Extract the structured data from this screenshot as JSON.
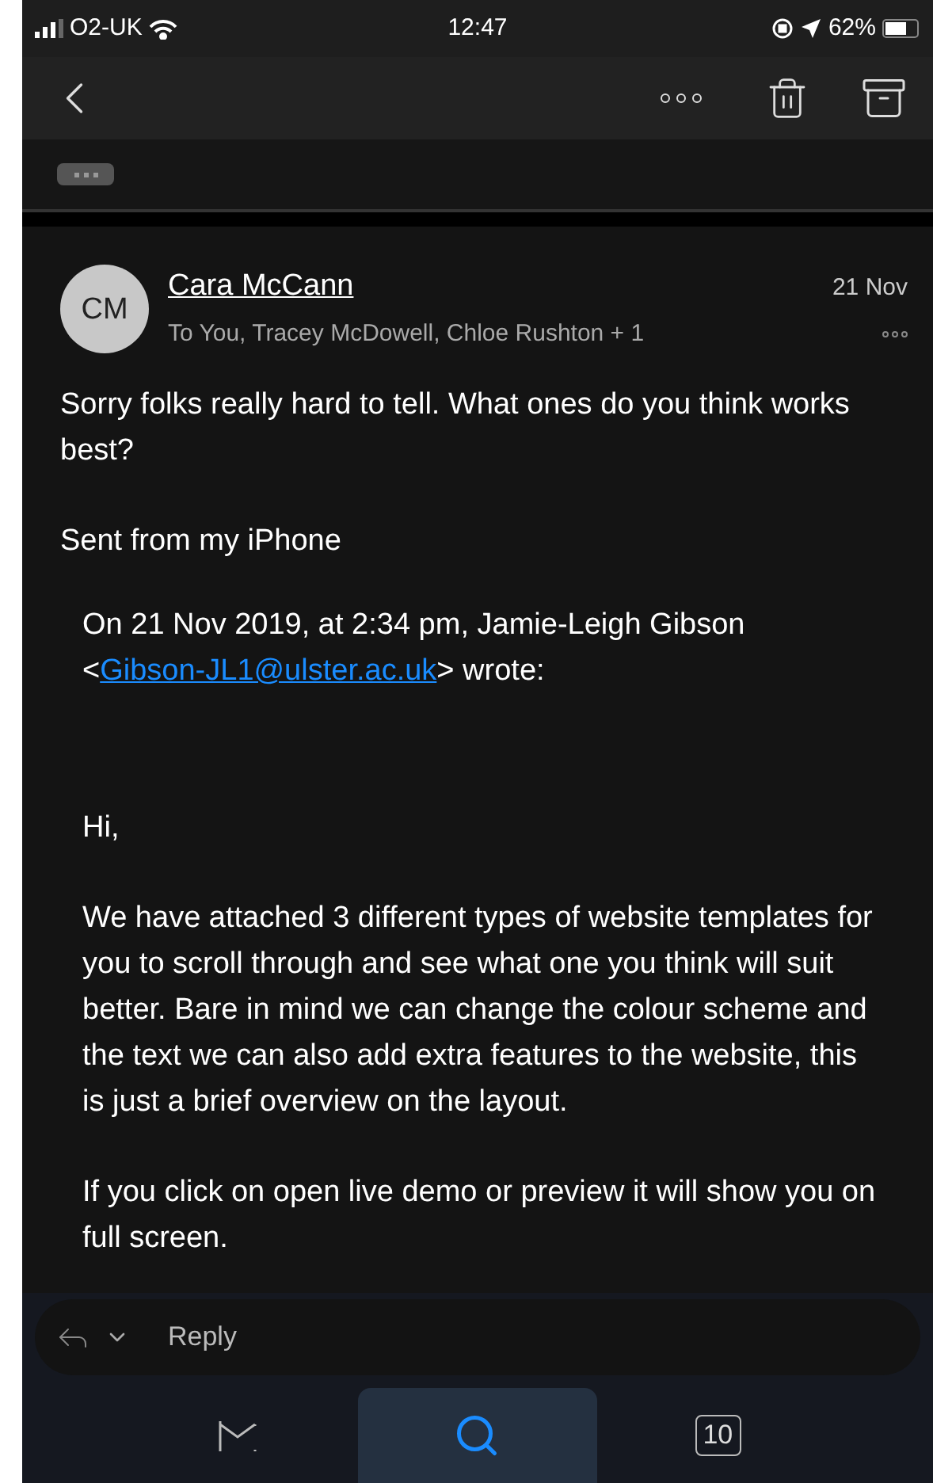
{
  "status_bar": {
    "carrier": "O2-UK",
    "time": "12:47",
    "battery": "62%"
  },
  "sender": {
    "initials": "CM",
    "name": "Cara McCann",
    "recipients": "To You, Tracey McDowell, Chloe Rushton + 1",
    "date": "21 Nov"
  },
  "body": [
    "Sorry folks really hard to tell. What ones do you think works best?",
    "Sent from my iPhone"
  ],
  "quote": {
    "intro_before": "On 21 Nov 2019, at 2:34 pm, Jamie-Leigh Gibson <",
    "email": "Gibson-JL1@ulster.ac.uk",
    "intro_after": "> wrote:",
    "paragraphs": [
      "Hi,",
      "We have attached 3 different types of website templates for you to scroll through and see what one you think will suit better. Bare in mind we can change the colour scheme and the text we can also add extra features to the website, this is just a brief overview on the layout.",
      "If you click on open live demo or preview it will show you on full screen."
    ]
  },
  "reply": {
    "label": "Reply"
  },
  "tabs": [
    {
      "kind": "mail",
      "selected": false
    },
    {
      "kind": "search",
      "selected": true
    },
    {
      "kind": "calendar",
      "label": "10",
      "selected": false
    }
  ]
}
